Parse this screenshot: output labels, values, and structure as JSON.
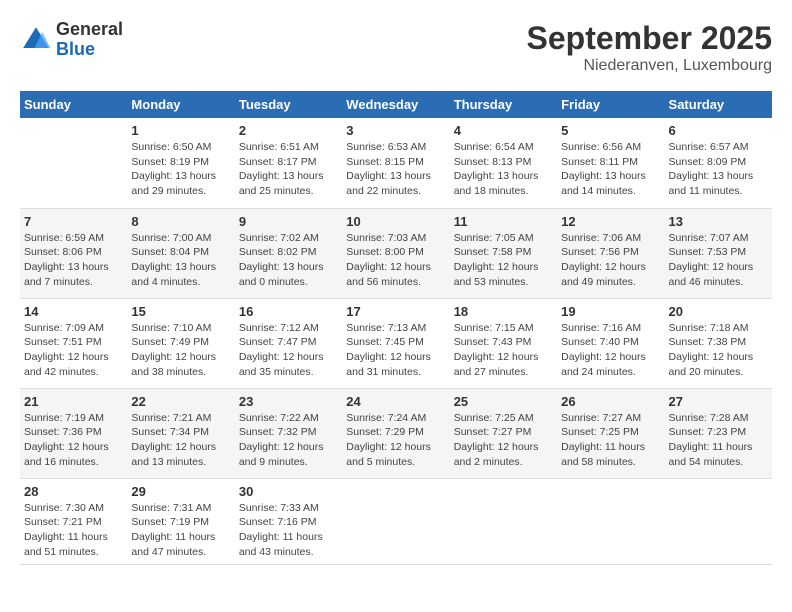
{
  "header": {
    "logo_general": "General",
    "logo_blue": "Blue",
    "month_title": "September 2025",
    "location": "Niederanven, Luxembourg"
  },
  "days_of_week": [
    "Sunday",
    "Monday",
    "Tuesday",
    "Wednesday",
    "Thursday",
    "Friday",
    "Saturday"
  ],
  "weeks": [
    [
      {
        "num": "",
        "info": ""
      },
      {
        "num": "1",
        "info": "Sunrise: 6:50 AM\nSunset: 8:19 PM\nDaylight: 13 hours\nand 29 minutes."
      },
      {
        "num": "2",
        "info": "Sunrise: 6:51 AM\nSunset: 8:17 PM\nDaylight: 13 hours\nand 25 minutes."
      },
      {
        "num": "3",
        "info": "Sunrise: 6:53 AM\nSunset: 8:15 PM\nDaylight: 13 hours\nand 22 minutes."
      },
      {
        "num": "4",
        "info": "Sunrise: 6:54 AM\nSunset: 8:13 PM\nDaylight: 13 hours\nand 18 minutes."
      },
      {
        "num": "5",
        "info": "Sunrise: 6:56 AM\nSunset: 8:11 PM\nDaylight: 13 hours\nand 14 minutes."
      },
      {
        "num": "6",
        "info": "Sunrise: 6:57 AM\nSunset: 8:09 PM\nDaylight: 13 hours\nand 11 minutes."
      }
    ],
    [
      {
        "num": "7",
        "info": "Sunrise: 6:59 AM\nSunset: 8:06 PM\nDaylight: 13 hours\nand 7 minutes."
      },
      {
        "num": "8",
        "info": "Sunrise: 7:00 AM\nSunset: 8:04 PM\nDaylight: 13 hours\nand 4 minutes."
      },
      {
        "num": "9",
        "info": "Sunrise: 7:02 AM\nSunset: 8:02 PM\nDaylight: 13 hours\nand 0 minutes."
      },
      {
        "num": "10",
        "info": "Sunrise: 7:03 AM\nSunset: 8:00 PM\nDaylight: 12 hours\nand 56 minutes."
      },
      {
        "num": "11",
        "info": "Sunrise: 7:05 AM\nSunset: 7:58 PM\nDaylight: 12 hours\nand 53 minutes."
      },
      {
        "num": "12",
        "info": "Sunrise: 7:06 AM\nSunset: 7:56 PM\nDaylight: 12 hours\nand 49 minutes."
      },
      {
        "num": "13",
        "info": "Sunrise: 7:07 AM\nSunset: 7:53 PM\nDaylight: 12 hours\nand 46 minutes."
      }
    ],
    [
      {
        "num": "14",
        "info": "Sunrise: 7:09 AM\nSunset: 7:51 PM\nDaylight: 12 hours\nand 42 minutes."
      },
      {
        "num": "15",
        "info": "Sunrise: 7:10 AM\nSunset: 7:49 PM\nDaylight: 12 hours\nand 38 minutes."
      },
      {
        "num": "16",
        "info": "Sunrise: 7:12 AM\nSunset: 7:47 PM\nDaylight: 12 hours\nand 35 minutes."
      },
      {
        "num": "17",
        "info": "Sunrise: 7:13 AM\nSunset: 7:45 PM\nDaylight: 12 hours\nand 31 minutes."
      },
      {
        "num": "18",
        "info": "Sunrise: 7:15 AM\nSunset: 7:43 PM\nDaylight: 12 hours\nand 27 minutes."
      },
      {
        "num": "19",
        "info": "Sunrise: 7:16 AM\nSunset: 7:40 PM\nDaylight: 12 hours\nand 24 minutes."
      },
      {
        "num": "20",
        "info": "Sunrise: 7:18 AM\nSunset: 7:38 PM\nDaylight: 12 hours\nand 20 minutes."
      }
    ],
    [
      {
        "num": "21",
        "info": "Sunrise: 7:19 AM\nSunset: 7:36 PM\nDaylight: 12 hours\nand 16 minutes."
      },
      {
        "num": "22",
        "info": "Sunrise: 7:21 AM\nSunset: 7:34 PM\nDaylight: 12 hours\nand 13 minutes."
      },
      {
        "num": "23",
        "info": "Sunrise: 7:22 AM\nSunset: 7:32 PM\nDaylight: 12 hours\nand 9 minutes."
      },
      {
        "num": "24",
        "info": "Sunrise: 7:24 AM\nSunset: 7:29 PM\nDaylight: 12 hours\nand 5 minutes."
      },
      {
        "num": "25",
        "info": "Sunrise: 7:25 AM\nSunset: 7:27 PM\nDaylight: 12 hours\nand 2 minutes."
      },
      {
        "num": "26",
        "info": "Sunrise: 7:27 AM\nSunset: 7:25 PM\nDaylight: 11 hours\nand 58 minutes."
      },
      {
        "num": "27",
        "info": "Sunrise: 7:28 AM\nSunset: 7:23 PM\nDaylight: 11 hours\nand 54 minutes."
      }
    ],
    [
      {
        "num": "28",
        "info": "Sunrise: 7:30 AM\nSunset: 7:21 PM\nDaylight: 11 hours\nand 51 minutes."
      },
      {
        "num": "29",
        "info": "Sunrise: 7:31 AM\nSunset: 7:19 PM\nDaylight: 11 hours\nand 47 minutes."
      },
      {
        "num": "30",
        "info": "Sunrise: 7:33 AM\nSunset: 7:16 PM\nDaylight: 11 hours\nand 43 minutes."
      },
      {
        "num": "",
        "info": ""
      },
      {
        "num": "",
        "info": ""
      },
      {
        "num": "",
        "info": ""
      },
      {
        "num": "",
        "info": ""
      }
    ]
  ]
}
